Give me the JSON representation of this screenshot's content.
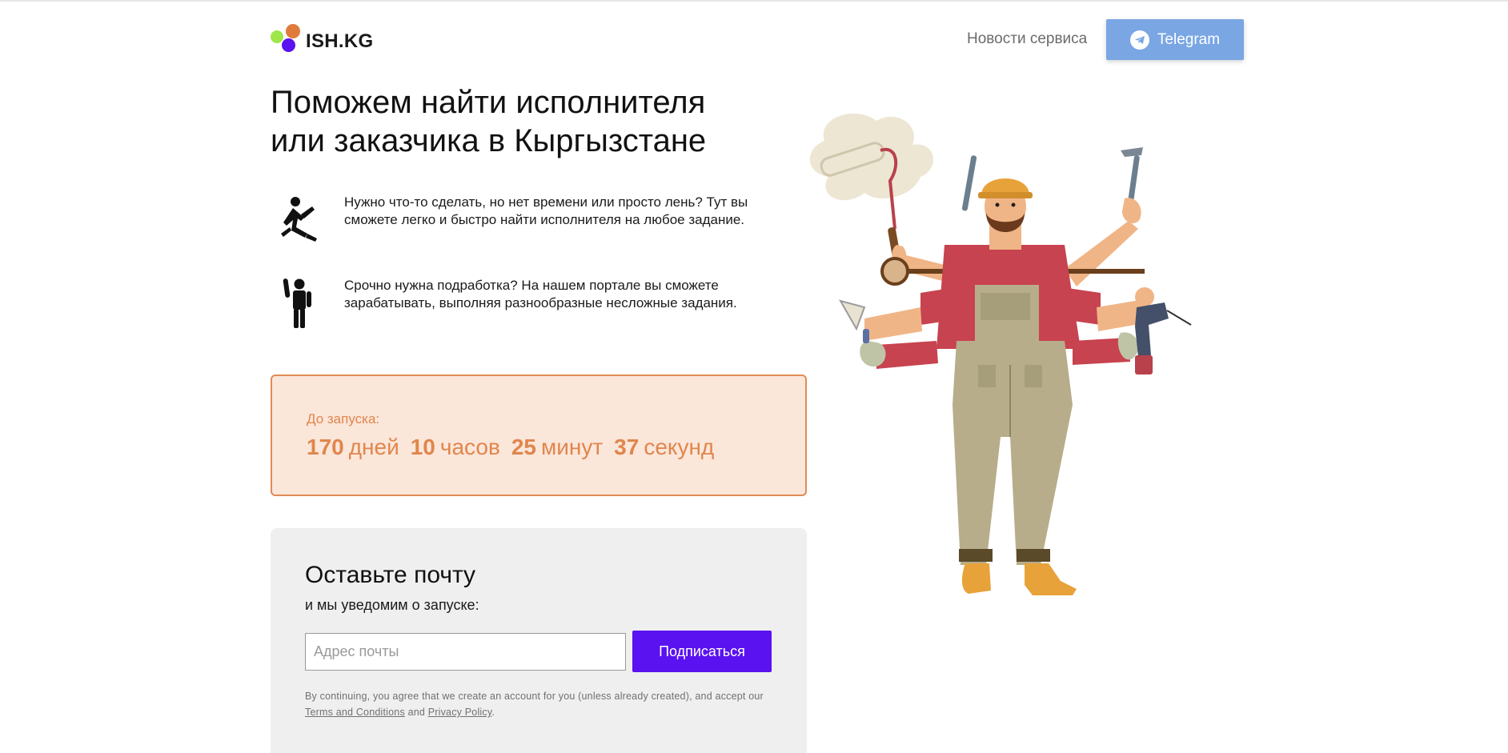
{
  "header": {
    "logo_text": "ISH.KG",
    "nav_link": "Новости сервиса",
    "telegram_label": "Telegram"
  },
  "hero": {
    "title": "Поможем найти исполнителя или заказчика в Кыргызстане",
    "features": [
      {
        "icon": "falling-person-icon",
        "text": "Нужно что-то сделать, но нет времени или просто лень? Тут вы сможете легко и быстро найти исполнителя на любое задание."
      },
      {
        "icon": "raised-hand-person-icon",
        "text": "Срочно нужна подработка? На нашем портале вы сможете зарабатывать, выполняя разнообразные несложные задания."
      }
    ]
  },
  "countdown": {
    "label": "До запуска:",
    "items": [
      {
        "value": "170",
        "unit": "дней"
      },
      {
        "value": "10",
        "unit": "часов"
      },
      {
        "value": "25",
        "unit": "минут"
      },
      {
        "value": "37",
        "unit": "секунд"
      }
    ]
  },
  "subscribe": {
    "title": "Оставьте почту",
    "subtitle": "и мы уведомим о запуске:",
    "email_placeholder": "Адрес почты",
    "email_value": "",
    "button_label": "Подписаться",
    "legal_prefix": "By continuing, you agree that we create an account for you (unless already created), and accept our ",
    "terms_label": "Terms and Conditions",
    "legal_and": " and ",
    "privacy_label": "Privacy Policy",
    "legal_suffix": "."
  },
  "illustration": {
    "name": "multi-armed-worker-illustration"
  },
  "colors": {
    "accent_orange": "#e0864c",
    "countdown_bg": "#fbe6da",
    "primary_purple": "#5a12f0",
    "telegram_blue": "#7aa6e3",
    "logo_green": "#9fe64a",
    "logo_orange": "#e07b3c",
    "logo_purple": "#5a12f0"
  }
}
